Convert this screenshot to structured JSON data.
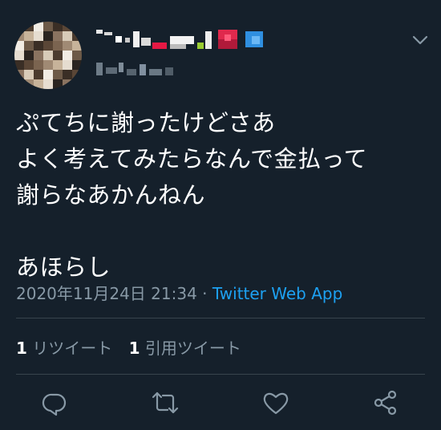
{
  "tweet": {
    "text": "ぷてちに謝ったけどさあ\nよく考えてみたらなんで金払って\n謝らなあかんねん\n\nあほらし",
    "date": "2020年11月24日 21:34",
    "separator": " · ",
    "source": "Twitter Web App"
  },
  "stats": {
    "retweets_count": "1",
    "retweets_label": "リツイート",
    "quotes_count": "1",
    "quotes_label": "引用ツイート"
  },
  "icons": {
    "menu": "chevron-down-icon",
    "reply": "reply-icon",
    "retweet": "retweet-icon",
    "like": "heart-icon",
    "share": "share-icon"
  },
  "colors": {
    "background": "#15202b",
    "text": "#ffffff",
    "muted": "#8899a6",
    "link": "#1da1f2",
    "divider": "#38444d"
  }
}
